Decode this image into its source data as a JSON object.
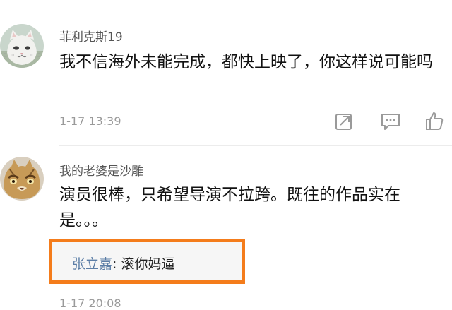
{
  "comments": [
    {
      "username": "菲利克斯19",
      "content": "我不信海外未能完成，都快上映了，你这样说可能吗",
      "time": "1-17 13:39",
      "avatar_icon": "white-cat-avatar"
    },
    {
      "username": "我的老婆是沙雕",
      "content": "演员很棒，只希望导演不拉跨。既往的作品实在是。。。",
      "avatar_icon": "cat-face-avatar",
      "reply": {
        "author": "张立嘉",
        "separator": ": ",
        "text": "滚你妈逼"
      },
      "time_partial": "1-17 20:08"
    }
  ],
  "icons": {
    "share": "share-icon",
    "comment": "comment-icon",
    "like": "thumbs-up-icon"
  },
  "colors": {
    "highlight_border": "#f47c1b",
    "reply_author": "#5b7da6"
  }
}
